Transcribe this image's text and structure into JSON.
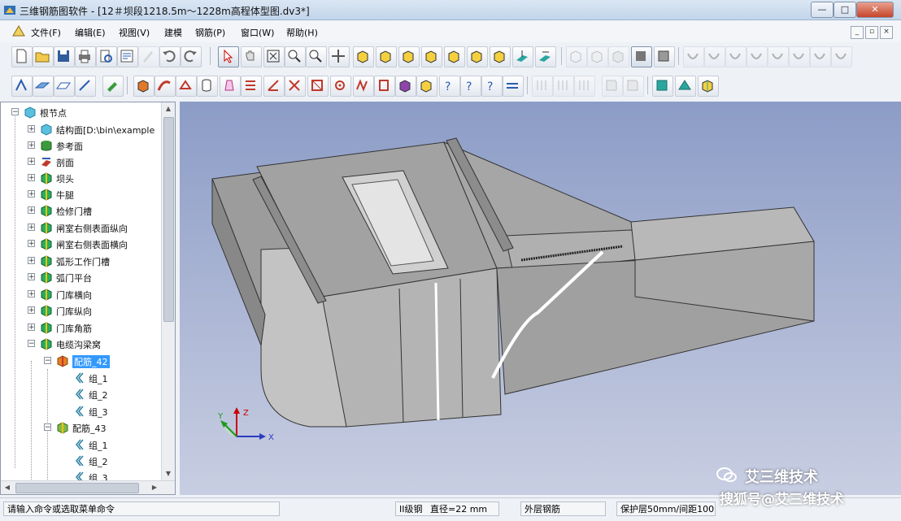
{
  "window": {
    "title": "三维钢筋图软件 - [12＃坝段1218.5m～1228m高程体型图.dv3*]",
    "controls": [
      "—",
      "□",
      "✕"
    ]
  },
  "menu": [
    {
      "label": "文件(F)"
    },
    {
      "label": "编辑(E)"
    },
    {
      "label": "视图(V)"
    },
    {
      "label": "建模"
    },
    {
      "label": "钢筋(P)"
    },
    {
      "label": "窗口(W)"
    },
    {
      "label": "帮助(H)"
    }
  ],
  "tree": {
    "nodes": [
      {
        "label": "根节点",
        "icon": "cube-icon"
      },
      {
        "label": "结构面[D:\\bin\\example",
        "icon": "cube-icon"
      },
      {
        "label": "参考面",
        "icon": "cylinder-icon"
      },
      {
        "label": "剖面",
        "icon": "section-icon"
      },
      {
        "label": "坝头",
        "icon": "assembly-icon"
      },
      {
        "label": "牛腿",
        "icon": "assembly-icon"
      },
      {
        "label": "检修门槽",
        "icon": "assembly-icon"
      },
      {
        "label": "闸室右侧表面纵向",
        "icon": "assembly-icon"
      },
      {
        "label": "闸室右侧表面横向",
        "icon": "assembly-icon"
      },
      {
        "label": "弧形工作门槽",
        "icon": "assembly-icon"
      },
      {
        "label": "弧门平台",
        "icon": "assembly-icon"
      },
      {
        "label": "门库横向",
        "icon": "assembly-icon"
      },
      {
        "label": "门库纵向",
        "icon": "assembly-icon"
      },
      {
        "label": "门库角筋",
        "icon": "assembly-icon"
      },
      {
        "label": "电缆沟梁窝",
        "icon": "assembly-icon"
      },
      {
        "label": "配筋_42",
        "icon": "rebar-set-icon"
      },
      {
        "label": "组_1",
        "icon": "group-icon"
      },
      {
        "label": "组_2",
        "icon": "group-icon"
      },
      {
        "label": "组_3",
        "icon": "group-icon"
      },
      {
        "label": "配筋_43",
        "icon": "rebar-set-icon"
      },
      {
        "label": "组_1",
        "icon": "group-icon"
      },
      {
        "label": "组_2",
        "icon": "group-icon"
      },
      {
        "label": "组_3",
        "icon": "group-icon"
      }
    ]
  },
  "axes": {
    "x": "X",
    "y": "Y",
    "z": "Z"
  },
  "status": {
    "prompt": "请输入命令或选取菜单命令",
    "bar_grade": "II级钢",
    "diameter": "直径=22 mm",
    "layer": "外层钢筋",
    "cover": "保护层50mm/间距100"
  },
  "watermark": {
    "brand": "艾三维技术",
    "source": "搜狐号@艾三维技术"
  },
  "colors": {
    "selection": "#3399ff",
    "model_top": "#9a9a9a",
    "model_side": "#b5b5b5"
  }
}
